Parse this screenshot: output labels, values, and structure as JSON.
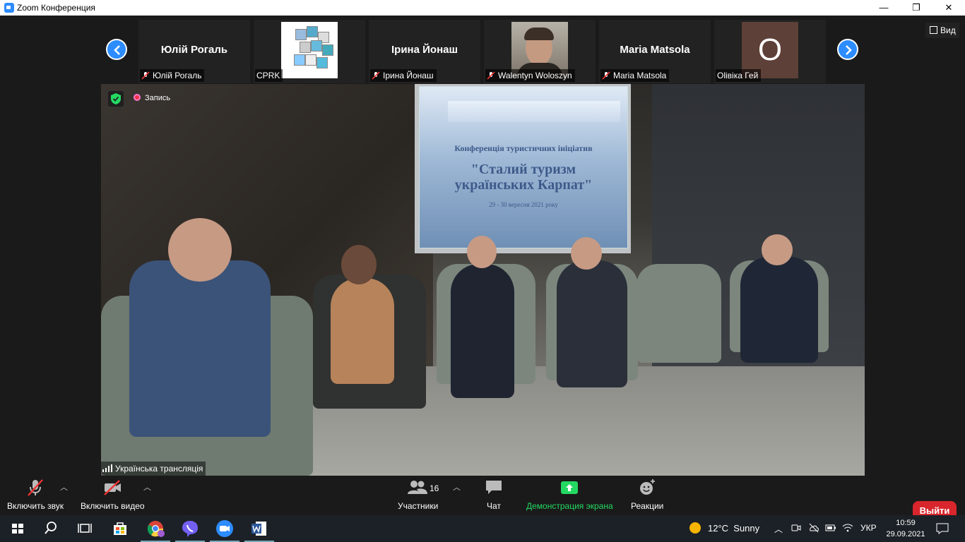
{
  "window": {
    "title": "Zoom Конференция",
    "minimize": "—",
    "maximize": "❐",
    "close": "✕"
  },
  "gallery": {
    "view_label": "Вид",
    "tiles": [
      {
        "big_name": "Юлій Рогаль",
        "label": "Юлій Рогаль",
        "muted": true
      },
      {
        "label": "CPRK",
        "muted": false
      },
      {
        "big_name": "Ірина Йонаш",
        "label": "Ірина Йонаш",
        "muted": true
      },
      {
        "label": "Walentyn Woloszyn",
        "muted": true
      },
      {
        "big_name": "Maria Matsola",
        "label": "Maria Matsola",
        "muted": true
      },
      {
        "avatar_letter": "O",
        "label": "Olівіка Гей",
        "muted": false
      }
    ]
  },
  "main_video": {
    "recording_label": "Запись",
    "speaker_label": "Українська трансляція",
    "slide": {
      "line1": "Конференція туристичних ініціатив",
      "line2": "\"Сталий туризм",
      "line3": "українських Карпат\"",
      "line4": "29 - 30 вересня 2021 року"
    }
  },
  "toolbar": {
    "audio": "Включить звук",
    "video": "Включить видео",
    "participants": "Участники",
    "participants_count": "16",
    "chat": "Чат",
    "share": "Демонстрация экрана",
    "reactions": "Реакции",
    "leave": "Выйти"
  },
  "taskbar": {
    "weather_temp": "12°C",
    "weather_desc": "Sunny",
    "lang": "УКР",
    "time": "10:59",
    "date": "29.09.2021"
  },
  "colors": {
    "accent": "#2d8cff",
    "share_green": "#23d962",
    "leave_red": "#d8262c"
  }
}
